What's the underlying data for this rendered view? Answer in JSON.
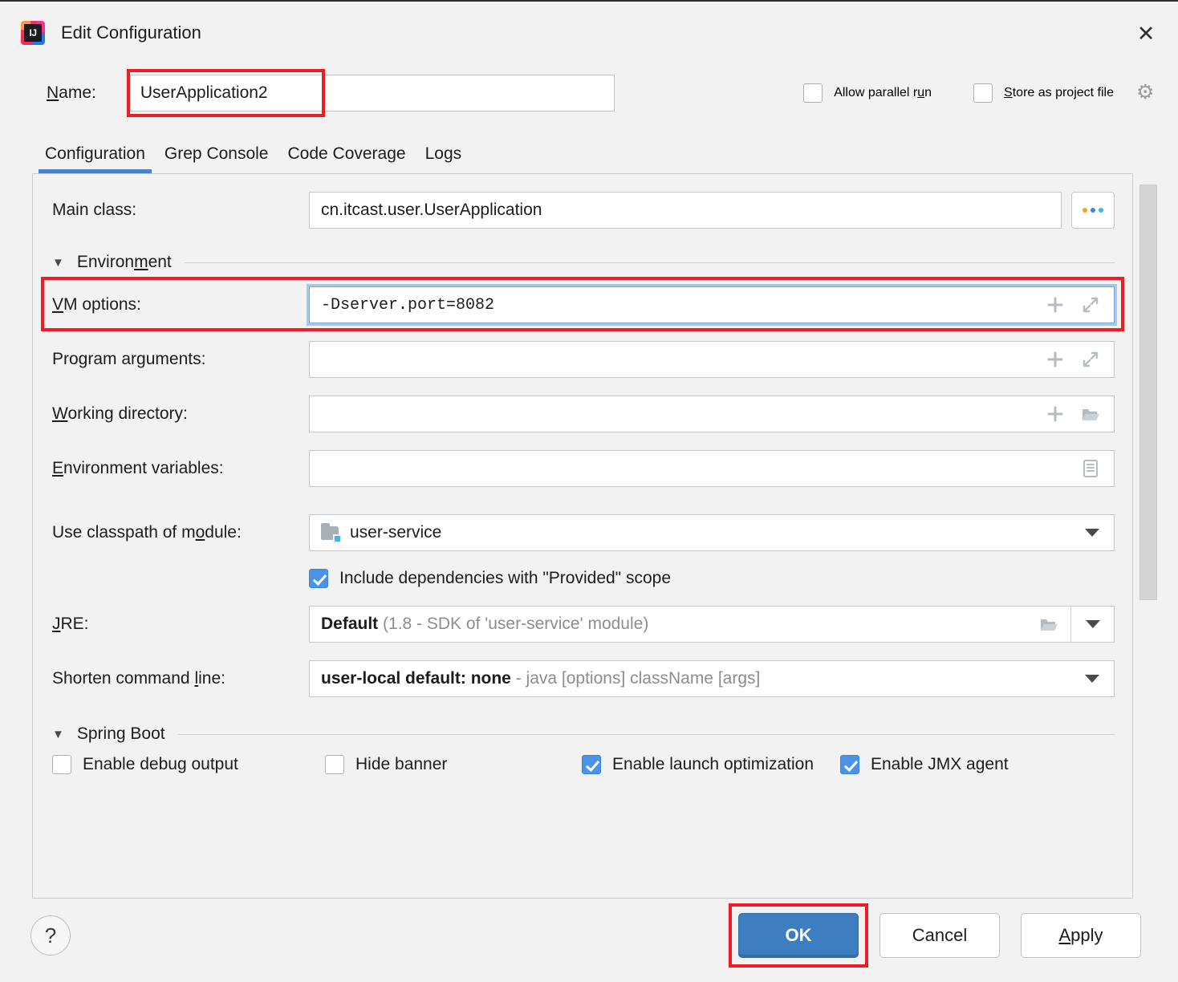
{
  "window": {
    "title": "Edit Configuration",
    "app_icon": "intellij-idea-icon",
    "close_icon": "close-icon"
  },
  "name_row": {
    "label": "Name:",
    "value": "UserApplication2",
    "highlighted": true
  },
  "top_options": {
    "allow_parallel_run": {
      "label": "Allow parallel run",
      "checked": false
    },
    "store_as_project_file": {
      "label": "Store as project file",
      "checked": false
    },
    "settings_icon": "gear-icon"
  },
  "tabs": [
    {
      "label": "Configuration",
      "active": true
    },
    {
      "label": "Grep Console",
      "active": false
    },
    {
      "label": "Code Coverage",
      "active": false
    },
    {
      "label": "Logs",
      "active": false
    }
  ],
  "form": {
    "main_class": {
      "label": "Main class:",
      "value": "cn.itcast.user.UserApplication",
      "browse_label": "..."
    },
    "environment_section": {
      "title": "Environment",
      "expanded": true,
      "caret": "caret-down-icon"
    },
    "vm_options": {
      "label": "VM options:",
      "value": "-Dserver.port=8082",
      "placeholder": "",
      "focused": true,
      "highlighted": true,
      "icons": [
        "plus-icon",
        "expand-icon"
      ]
    },
    "program_arguments": {
      "label": "Program arguments:",
      "value": "",
      "icons": [
        "plus-icon",
        "expand-icon"
      ]
    },
    "working_directory": {
      "label": "Working directory:",
      "value": "",
      "icons": [
        "plus-icon",
        "folder-icon"
      ]
    },
    "environment_variables": {
      "label": "Environment variables:",
      "value": "",
      "icons": [
        "document-list-icon"
      ]
    },
    "classpath_module": {
      "label": "Use classpath of module:",
      "value": "user-service",
      "module_icon": "module-folder-icon",
      "dropdown_icon": "chevron-down-icon"
    },
    "include_provided": {
      "label": "Include dependencies with \"Provided\" scope",
      "checked": true
    },
    "jre": {
      "label": "JRE:",
      "value_primary": "Default",
      "value_secondary": "(1.8 - SDK of 'user-service' module)",
      "folder_icon": "folder-icon",
      "dropdown_icon": "chevron-down-icon"
    },
    "shorten_command_line": {
      "label": "Shorten command line:",
      "value_primary": "user-local default: none",
      "value_secondary": "- java [options] className [args]",
      "dropdown_icon": "chevron-down-icon"
    },
    "spring_boot_section": {
      "title": "Spring Boot",
      "expanded": true,
      "caret": "caret-down-icon"
    },
    "spring_boot_options": [
      {
        "label": "Enable debug output",
        "checked": false
      },
      {
        "label": "Hide banner",
        "checked": false
      },
      {
        "label": "Enable launch optimization",
        "checked": true
      },
      {
        "label": "Enable JMX agent",
        "checked": true
      }
    ]
  },
  "buttons": {
    "help": "?",
    "ok": "OK",
    "cancel": "Cancel",
    "apply": "Apply",
    "ok_highlighted": true
  },
  "colors": {
    "accent_blue": "#3b86dd",
    "primary_button": "#3c7ebf",
    "highlight_red": "#ee1c25",
    "checkbox_checked": "#4a93e8",
    "dialog_background": "#f2f2f2",
    "field_background": "#ffffff",
    "muted_text": "#8d8d8d"
  }
}
